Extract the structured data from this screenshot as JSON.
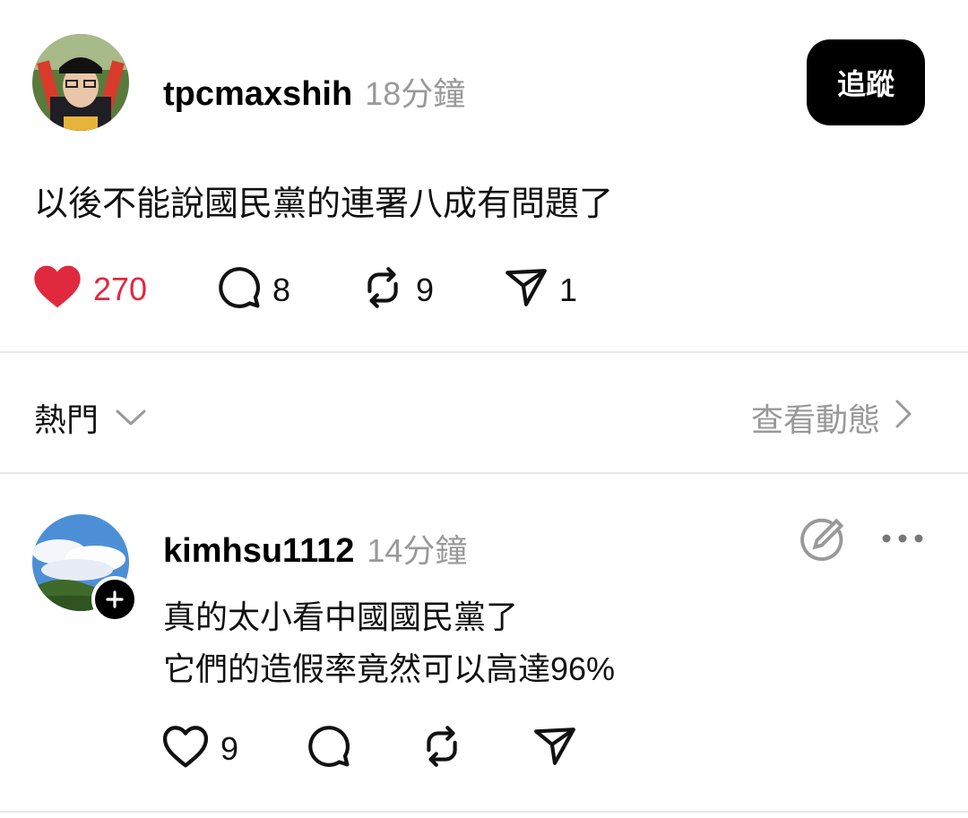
{
  "post": {
    "username": "tpcmaxshih",
    "time": "18分鐘",
    "follow_label": "追蹤",
    "text": "以後不能說國民黨的連署八成有問題了",
    "actions": {
      "likes": "270",
      "comments": "8",
      "reposts": "9",
      "shares": "1"
    },
    "liked": true
  },
  "thread_bar": {
    "sort_label": "熱門",
    "activity_label": "查看動態"
  },
  "reply": {
    "username": "kimhsu1112",
    "time": "14分鐘",
    "lines": [
      "真的太小看中國國民黨了",
      "它們的造假率竟然可以高達96%"
    ],
    "actions": {
      "likes": "9"
    }
  },
  "colors": {
    "accent_like": "#e0283f",
    "muted": "#999999",
    "divider": "#e8e8e8"
  }
}
